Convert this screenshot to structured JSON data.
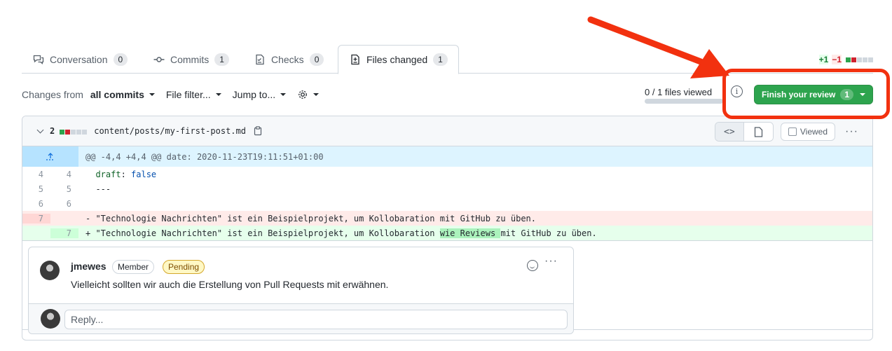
{
  "tabs": [
    {
      "label": "Conversation",
      "count": "0"
    },
    {
      "label": "Commits",
      "count": "1"
    },
    {
      "label": "Checks",
      "count": "0"
    },
    {
      "label": "Files changed",
      "count": "1"
    }
  ],
  "diffstat": {
    "additions": "+1",
    "deletions": "−1"
  },
  "toolbar": {
    "changes_from_prefix": "Changes from",
    "changes_from_value": "all commits",
    "file_filter": "File filter...",
    "jump_to": "Jump to...",
    "files_viewed": "0 / 1 files viewed",
    "files_viewed_progress": 0,
    "finish_review_label": "Finish your review",
    "finish_review_count": "1"
  },
  "file": {
    "changes": "2",
    "path": "content/posts/my-first-post.md",
    "viewed_label": "Viewed",
    "hunk_header": "@@ -4,4 +4,4 @@ date: 2020-11-23T19:11:51+01:00",
    "lines": {
      "l1_old": "4",
      "l1_new": "4",
      "l1_key": "draft",
      "l1_colon": ": ",
      "l1_val": "false",
      "l2_old": "5",
      "l2_new": "5",
      "l2_text": "---",
      "l3_old": "6",
      "l3_new": "6",
      "del_old": "7",
      "del_text": "- \"Technologie Nachrichten\" ist ein Beispielprojekt, um Kollobaration mit GitHub zu üben.",
      "add_new": "7",
      "add_prefix": "+ \"Technologie Nachrichten\" ist ein Beispielprojekt, um Kollobaration ",
      "add_highlight": "wie Reviews ",
      "add_suffix": "mit GitHub zu üben."
    }
  },
  "comment": {
    "author": "jmewes",
    "role_label": "Member",
    "status_label": "Pending",
    "body": "Vielleicht sollten wir auch die Erstellung von Pull Requests mit erwähnen.",
    "reply_placeholder": "Reply..."
  },
  "colors": {
    "accent_green": "#2da44e",
    "annotation_red": "#f2310f"
  }
}
